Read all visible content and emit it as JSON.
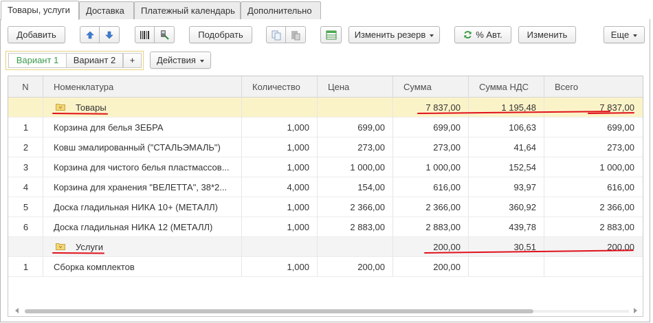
{
  "tabs": [
    {
      "label": "Товары, услуги",
      "active": true
    },
    {
      "label": "Доставка",
      "active": false
    },
    {
      "label": "Платежный календарь",
      "active": false
    },
    {
      "label": "Дополнительно",
      "active": false
    }
  ],
  "toolbar": {
    "add": "Добавить",
    "select": "Подобрать",
    "change_reserve": "Изменить резерв",
    "percent_auto": "% Авт.",
    "change": "Изменить",
    "more": "Еще"
  },
  "variants": {
    "items": [
      "Вариант 1",
      "Вариант 2"
    ],
    "add": "+",
    "actions": "Действия"
  },
  "table": {
    "columns": [
      "N",
      "Номенклатура",
      "Количество",
      "Цена",
      "Сумма",
      "Сумма НДС",
      "Всего"
    ],
    "groups": [
      {
        "name": "Товары",
        "sum": "7 837,00",
        "vat": "1 195,48",
        "total": "7 837,00",
        "rows": [
          {
            "n": "1",
            "name": "Корзина для белья ЗЕБРА",
            "qty": "1,000",
            "price": "699,00",
            "sum": "699,00",
            "vat": "106,63",
            "total": "699,00"
          },
          {
            "n": "2",
            "name": "Ковш эмалированный (\"СТАЛЬЭМАЛЬ\")",
            "qty": "1,000",
            "price": "273,00",
            "sum": "273,00",
            "vat": "41,64",
            "total": "273,00"
          },
          {
            "n": "3",
            "name": "Корзина для чистого белья пластмассов...",
            "qty": "1,000",
            "price": "1 000,00",
            "sum": "1 000,00",
            "vat": "152,54",
            "total": "1 000,00"
          },
          {
            "n": "4",
            "name": "Корзина для хранения \"ВЕЛЕТТА\", 38*2...",
            "qty": "4,000",
            "price": "154,00",
            "sum": "616,00",
            "vat": "93,97",
            "total": "616,00"
          },
          {
            "n": "5",
            "name": "Доска гладильная  НИКА 10+ (МЕТАЛЛ)",
            "qty": "1,000",
            "price": "2 366,00",
            "sum": "2 366,00",
            "vat": "360,92",
            "total": "2 366,00"
          },
          {
            "n": "6",
            "name": "Доска гладильная  НИКА 12 (МЕТАЛЛ)",
            "qty": "1,000",
            "price": "2 883,00",
            "sum": "2 883,00",
            "vat": "439,78",
            "total": "2 883,00"
          }
        ]
      },
      {
        "name": "Услуги",
        "sum": "200,00",
        "vat": "30,51",
        "total": "200,00",
        "rows": [
          {
            "n": "1",
            "name": "Сборка комплектов",
            "qty": "1,000",
            "price": "200,00",
            "sum": "200,00",
            "vat": "",
            "total": ""
          }
        ]
      }
    ]
  },
  "colors": {
    "group_row": "#fbf3c8",
    "annotation": "#e0101a",
    "active_variant": "#3a9b4d"
  }
}
